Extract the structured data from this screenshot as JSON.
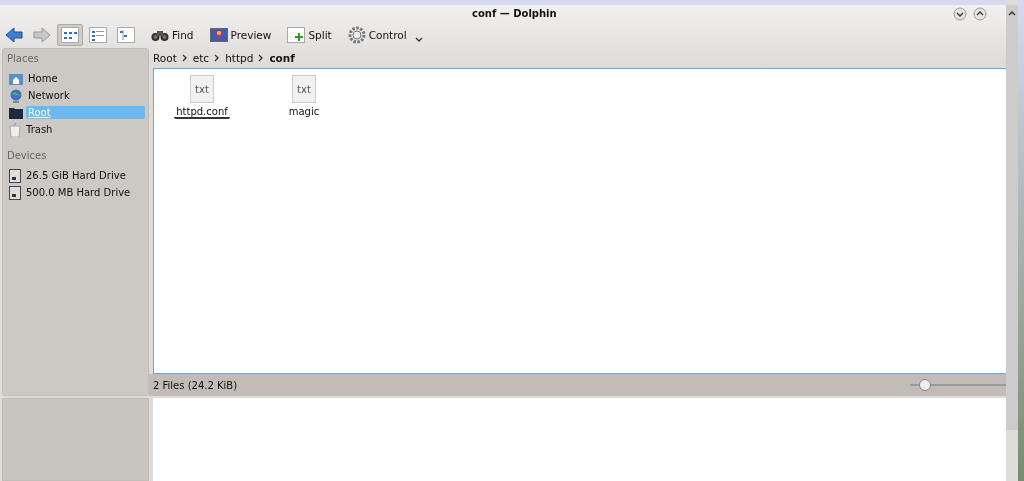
{
  "window": {
    "title": "conf — Dolphin"
  },
  "toolbar": [
    {
      "kind": "back"
    },
    {
      "kind": "forward"
    },
    {
      "kind": "icons-view",
      "selected": true
    },
    {
      "kind": "details-view",
      "selected": false
    },
    {
      "kind": "columns-view",
      "selected": false
    },
    {
      "kind": "find",
      "label": "Find"
    },
    {
      "kind": "preview",
      "label": "Preview"
    },
    {
      "kind": "split",
      "label": "Split"
    },
    {
      "kind": "control",
      "label": "Control"
    }
  ],
  "places": {
    "heading": "Places",
    "items": [
      {
        "kind": "home",
        "label": "Home",
        "selected": false
      },
      {
        "kind": "network",
        "label": "Network",
        "selected": false
      },
      {
        "kind": "folder",
        "label": "Root",
        "selected": true
      },
      {
        "kind": "trash",
        "label": "Trash",
        "selected": false
      }
    ]
  },
  "devices": {
    "heading": "Devices",
    "items": [
      {
        "label": "26.5 GiB Hard Drive"
      },
      {
        "label": "500.0 MB Hard Drive"
      }
    ]
  },
  "breadcrumb": [
    {
      "label": "Root",
      "current": false
    },
    {
      "label": "etc",
      "current": false
    },
    {
      "label": "httpd",
      "current": false
    },
    {
      "label": "conf",
      "current": true
    }
  ],
  "files": [
    {
      "name": "httpd.conf",
      "type_label": "txt",
      "hovered": true
    },
    {
      "name": "magic",
      "type_label": "txt",
      "hovered": false
    }
  ],
  "status_bar": {
    "text": "2 Files (24.2 KiB)",
    "zoom": {
      "level": 0.15
    }
  }
}
